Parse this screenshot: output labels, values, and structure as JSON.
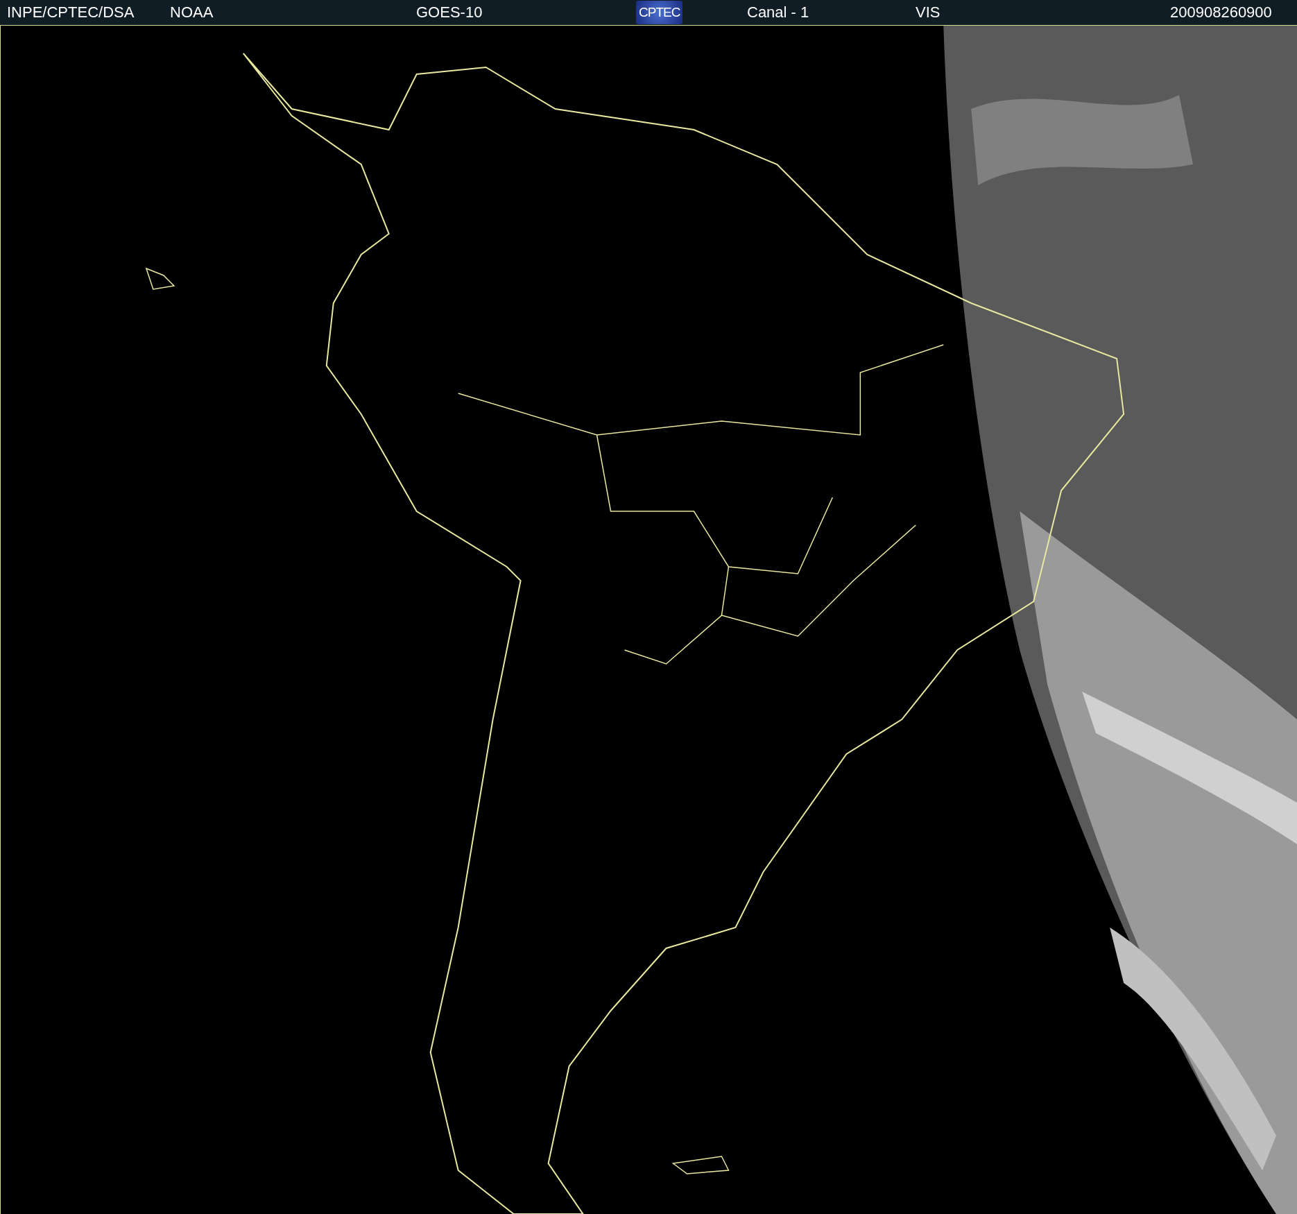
{
  "header": {
    "items": [
      {
        "kind": "text",
        "text": "INPE/CPTEC/DSA"
      },
      {
        "kind": "text",
        "text": "NOAA"
      },
      {
        "kind": "text",
        "text": "GOES-10"
      },
      {
        "kind": "logo",
        "text": "CPTEC"
      },
      {
        "kind": "text",
        "text": "Canal - 1"
      },
      {
        "kind": "text",
        "text": "VIS"
      },
      {
        "kind": "text",
        "text": "200908260900"
      }
    ]
  }
}
